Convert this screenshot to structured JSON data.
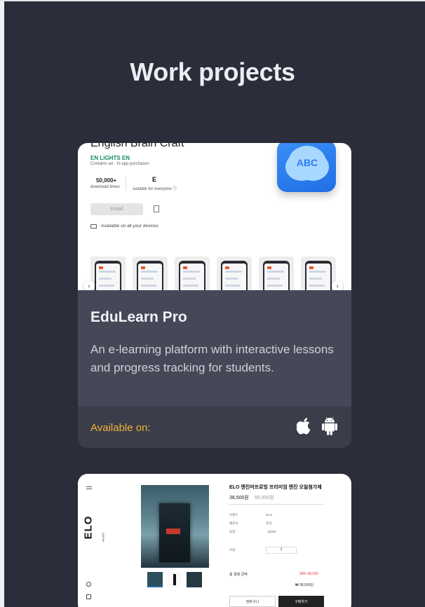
{
  "section": {
    "title": "Work projects"
  },
  "project1": {
    "screenshot": {
      "app_name": "English Brain Craft",
      "developer": "EN LIGHTS EN",
      "meta": "Contains ad · In-app purchases",
      "downloads_value": "50,000+",
      "downloads_label": "download times",
      "rating_badge": "E",
      "rating_label": "suitable for everyone ⓘ",
      "install_label": "Install",
      "devices_label": "Available on all your devices",
      "app_icon_text": "ABC",
      "nav_prev": "‹",
      "nav_next": "›"
    },
    "title": "EduLearn Pro",
    "description": "An e-learning platform with interactive lessons and progress tracking for students.",
    "available_label": "Available on:",
    "platforms": [
      "apple-icon",
      "android-icon"
    ],
    "accent_color": "#f2b233"
  },
  "project2": {
    "screenshot": {
      "brand": "ELO",
      "brand_sub": "MICRO",
      "product_title": "ELO 엔진머프로빙 프리미엄 엔진 오일첨가제",
      "price": "38,500원",
      "sub_price": "56,000원",
      "spec1_label": "브랜드",
      "spec1_value": "ELO",
      "spec2_label": "제조국",
      "spec2_value": "한국",
      "spec3_label": "용량",
      "spec3_value": "150ml",
      "qty_label": "수량",
      "qty_value": "1",
      "total_label": "총 결제 금액",
      "total_red": "34%  38,500",
      "total_value": "₩ 38,500원",
      "cart_label": "장바구니",
      "buy_label": "구매하기"
    }
  }
}
